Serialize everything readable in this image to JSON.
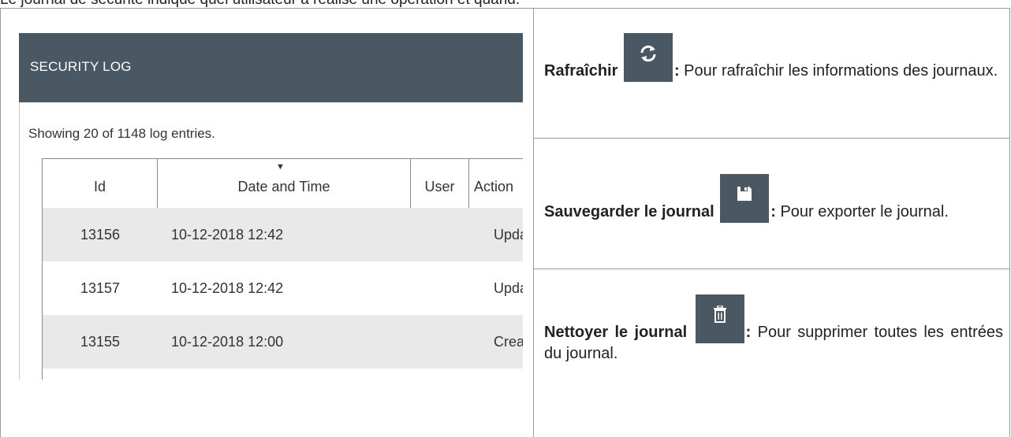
{
  "caption": "Le journal de sécurité indique quel utilisateur a réalisé une opération et quand.",
  "security_log": {
    "title": "SECURITY LOG",
    "count_text": "Showing 20 of 1148 log entries.",
    "columns": [
      "Id",
      "Date and Time",
      "User",
      "Action"
    ],
    "sort_indicator": "▼",
    "rows": [
      {
        "id": "13156",
        "datetime": "10-12-2018 12:42",
        "user": "",
        "action": "Upda"
      },
      {
        "id": "13157",
        "datetime": "10-12-2018 12:42",
        "user": "",
        "action": "Upda"
      },
      {
        "id": "13155",
        "datetime": "10-12-2018 12:00",
        "user": "",
        "action": "Creat"
      }
    ]
  },
  "descriptions": [
    {
      "term": "Rafraîchir",
      "colon": ":",
      "text": "Pour rafraîchir les informations des journaux.",
      "icon": "refresh-icon"
    },
    {
      "term": "Sauvegarder le journal",
      "colon": ":",
      "text": "Pour exporter le journal.",
      "icon": "save-icon"
    },
    {
      "term": "Nettoyer le journal",
      "colon": ":",
      "text": "Pour supprimer toutes les entrées du journal.",
      "icon": "trash-icon"
    }
  ],
  "colors": {
    "header_bg": "#4a5863",
    "row_alt": "#e9e9e9"
  }
}
